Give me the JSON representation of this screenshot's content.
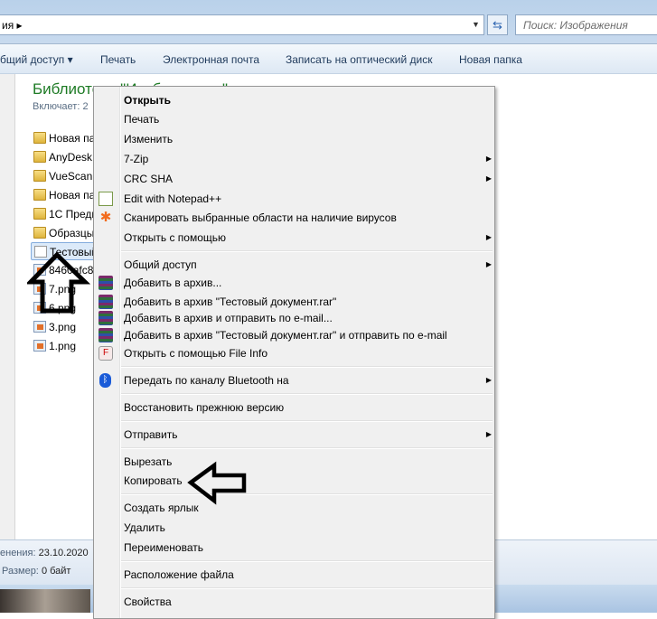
{
  "address": {
    "crumb": "ия ▸",
    "search_placeholder": "Поиск: Изображения"
  },
  "toolbar": {
    "share": "бщий доступ ▾",
    "print": "Печать",
    "email": "Электронная почта",
    "burn": "Записать на оптический диск",
    "new_folder": "Новая папка"
  },
  "library": {
    "title": "Библиотека \"Изображения\"",
    "includes": "Включает:  2"
  },
  "files": [
    "Новая папка",
    "AnyDesk",
    "VueScan",
    "Новая папка",
    "1С Предприятие",
    "Образцы",
    "Тестовый документ",
    "8460afc83",
    "7.png",
    "6.png",
    "3.png",
    "1.png"
  ],
  "details": {
    "modified_label": "енения:",
    "modified_value": "23.10.2020",
    "size_label": "Размер:",
    "size_value": "0 байт"
  },
  "menu": {
    "open": "Открыть",
    "print": "Печать",
    "edit": "Изменить",
    "zip": "7-Zip",
    "crc": "CRC SHA",
    "notepad": "Edit with Notepad++",
    "scan": "Сканировать выбранные области на наличие вирусов",
    "open_with": "Открыть с помощью",
    "share": "Общий доступ",
    "add_archive": "Добавить в архив...",
    "add_rar": "Добавить в архив \"Тестовый документ.rar\"",
    "add_email": "Добавить в архив и отправить по e-mail...",
    "add_rar_email": "Добавить в архив \"Тестовый документ.rar\" и отправить по e-mail",
    "fileinfo": "Открыть с помощью File Info",
    "bluetooth": "Передать по каналу Bluetooth на",
    "restore": "Восстановить прежнюю версию",
    "send": "Отправить",
    "cut": "Вырезать",
    "copy": "Копировать",
    "shortcut": "Создать ярлык",
    "delete": "Удалить",
    "rename": "Переименовать",
    "location": "Расположение файла",
    "properties": "Свойства"
  }
}
